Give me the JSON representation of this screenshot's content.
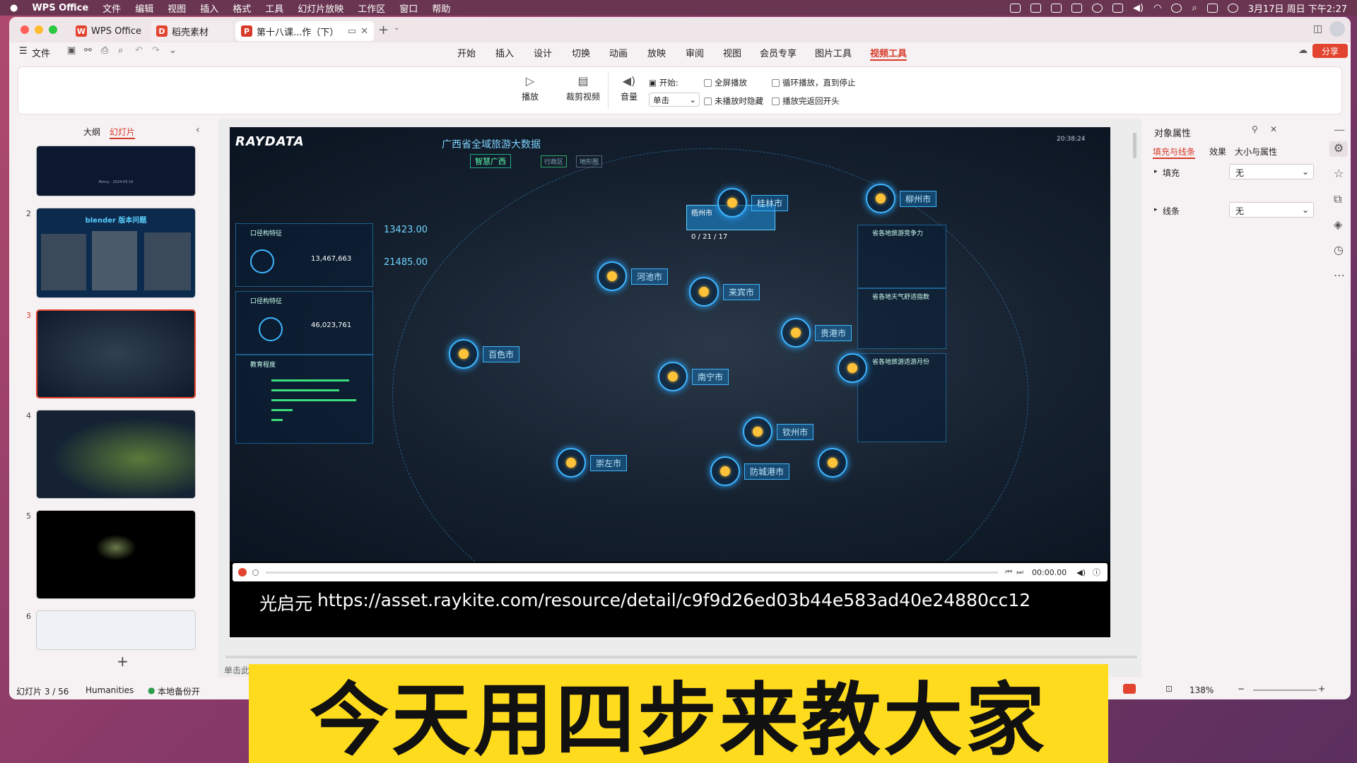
{
  "menubar": {
    "app": "WPS Office",
    "items": [
      "文件",
      "编辑",
      "视图",
      "插入",
      "格式",
      "工具",
      "幻灯片放映",
      "工作区",
      "窗口",
      "帮助"
    ],
    "clock": "3月17日 周日 下午2:27"
  },
  "tabs": [
    {
      "label": "WPS Office",
      "icon": "W"
    },
    {
      "label": "稻壳素材",
      "icon": "D"
    },
    {
      "label": "第十八课...作（下）",
      "icon": "P"
    }
  ],
  "ribbon_left": {
    "file": "文件"
  },
  "ribbon_tabs": [
    "开始",
    "插入",
    "设计",
    "切换",
    "动画",
    "放映",
    "审阅",
    "视图",
    "会员专享",
    "图片工具",
    "视频工具"
  ],
  "active_ribbon_tab": "视频工具",
  "share_label": "分享",
  "toolbar": {
    "play": "播放",
    "trim": "裁剪视频",
    "volume": "音量",
    "start_label": "开始:",
    "start_value": "单击",
    "fullscreen": "全屏播放",
    "hide_not_playing": "未播放时隐藏",
    "loop": "循环播放，直到停止",
    "rewind": "播放完返回开头"
  },
  "left_pane": {
    "tab_outline": "大纲",
    "tab_slides": "幻灯片",
    "slide_numbers": [
      "2",
      "3",
      "4",
      "5",
      "6"
    ],
    "slide2_title": "blender 版本问题",
    "slide1_text": "Penny · 2024-03-16",
    "add": "+"
  },
  "video": {
    "brand": "RAYDATA",
    "title": "广西省全域旅游大数据",
    "subtitle": "智慧广西",
    "chip1": "行政区",
    "chip2": "地形图",
    "time": "20:38:24",
    "cities": [
      "河池市",
      "柳州市",
      "贵港市",
      "百色市",
      "南宁市",
      "钦州市",
      "崇左市",
      "防城港市",
      "桂林市",
      "来宾市"
    ],
    "highlight_city": "梧州市",
    "highlight_vals": "0 / 21 / 17",
    "panel1_title": "口径构特征",
    "panel1_value": "13,467,663",
    "panel2_title": "口径构特征",
    "panel2_value": "46,023,761",
    "panel3_title": "教育程度",
    "stat1": "13423.00",
    "stat2": "21485.00",
    "right1": "省各地旅游竞争力",
    "right2": "省各地天气舒适指数",
    "right3": "省各地旅游适游月份"
  },
  "player": {
    "time": "00:00.00"
  },
  "caption": {
    "author": "光启元",
    "url": "https://asset.raykite.com/resource/detail/c9f9d26ed03b44e583ad40e24880cc12"
  },
  "right_panel": {
    "title": "对象属性",
    "tabs": [
      "填充与线条",
      "效果",
      "大小与属性"
    ],
    "fill_label": "填充",
    "fill_value": "无",
    "line_label": "线条",
    "line_value": "无"
  },
  "statusbar": {
    "slide_info": "幻灯片 3 / 56",
    "theme": "Humanities",
    "backup": "本地备份开",
    "click_hint": "单击此",
    "zoom": "138%"
  },
  "banner": "今天用四步来教大家",
  "colors": {
    "accent": "#e2442f",
    "banner_bg": "#ffdb1e",
    "video_blue": "#3fb6ff"
  }
}
